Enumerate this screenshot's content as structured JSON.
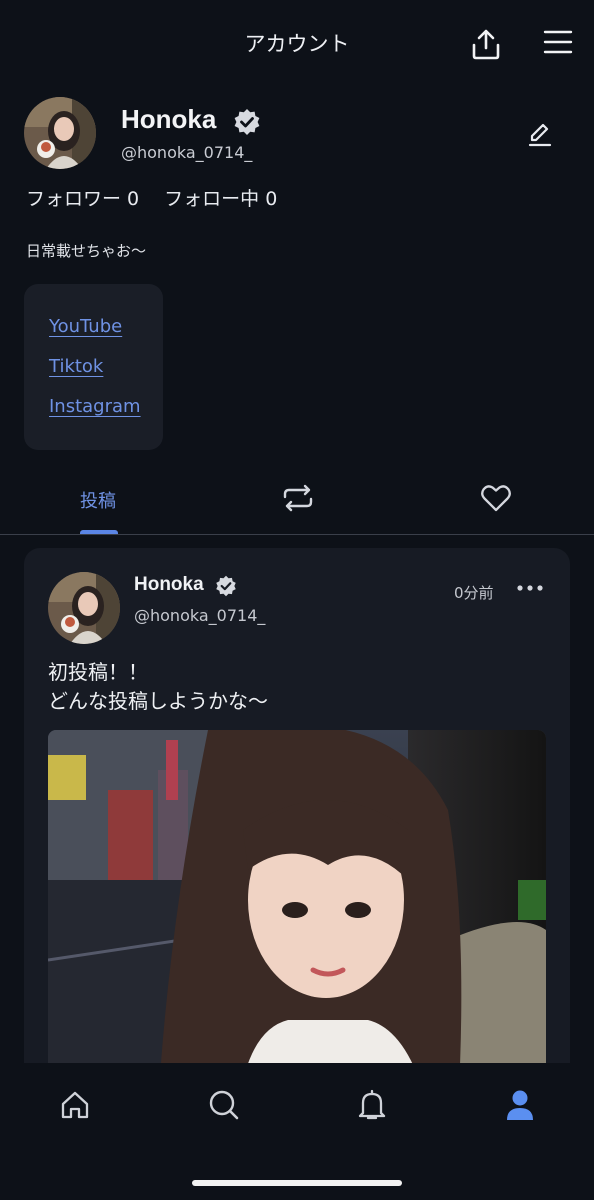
{
  "header": {
    "title": "アカウント",
    "share_icon": "share-upload-icon",
    "menu_icon": "hamburger-menu-icon"
  },
  "profile": {
    "display_name": "Honoka",
    "handle": "@honoka_0714_",
    "verified_icon": "verified-badge-icon",
    "edit_icon": "pencil-edit-icon",
    "follow_stats": "フォロワー 0　 フォロー中 0",
    "bio": "日常載せちゃお〜",
    "links": [
      "YouTube",
      "Tiktok",
      "Instagram"
    ]
  },
  "tabs": {
    "posts_label": "投稿",
    "repost_icon": "repost-icon",
    "likes_icon": "heart-icon"
  },
  "post": {
    "display_name": "Honoka",
    "handle": "@honoka_0714_",
    "time": "0分前",
    "more_icon": "more-horizontal-icon",
    "text_line1": "初投稿！！",
    "text_line2": "どんな投稿しようかな〜",
    "photo": "selfie-photo"
  },
  "bottom_nav": {
    "items": [
      "home-icon",
      "search-icon",
      "bell-icon",
      "profile-icon"
    ],
    "active": "profile-icon"
  },
  "colors": {
    "background": "#0d1118",
    "card": "#171b24",
    "accent": "#6f92e4"
  }
}
